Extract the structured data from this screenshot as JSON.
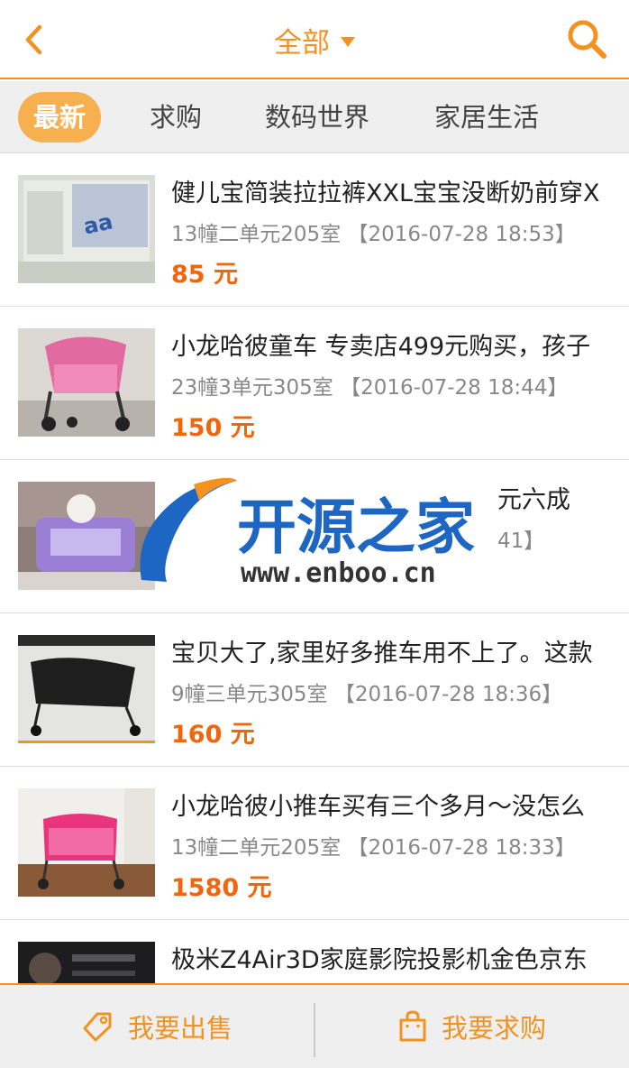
{
  "header": {
    "title": "全部",
    "accent_color": "#f39221",
    "back_icon": "chevron-left-icon",
    "search_icon": "search-icon"
  },
  "tabs": [
    {
      "label": "最新",
      "active": true
    },
    {
      "label": "求购",
      "active": false
    },
    {
      "label": "数码世界",
      "active": false
    },
    {
      "label": "家居生活",
      "active": false
    }
  ],
  "items": [
    {
      "title": "健儿宝简装拉拉裤XXL宝宝没断奶前穿X",
      "address": "13幢二单元205室",
      "time": "【2016-07-28 18:53】",
      "price": "85 元"
    },
    {
      "title": "小龙哈彼童车 专卖店499元购买，孩子",
      "address": "23幢3单元305室",
      "time": "【2016-07-28 18:44】",
      "price": "150 元"
    },
    {
      "title": "元六成",
      "address": "",
      "time": "41】",
      "price": ""
    },
    {
      "title": "宝贝大了,家里好多推车用不上了。这款",
      "address": "9幢三单元305室",
      "time": "【2016-07-28 18:36】",
      "price": "160 元"
    },
    {
      "title": "小龙哈彼小推车买有三个多月～没怎么",
      "address": "13幢二单元205室",
      "time": "【2016-07-28 18:33】",
      "price": "1580 元"
    },
    {
      "title": "极米Z4Air3D家庭影院投影机金色京东",
      "address": "",
      "time": "",
      "price": ""
    }
  ],
  "watermark": {
    "name": "开源之家",
    "url": "www.enboo.cn"
  },
  "bottom_bar": {
    "sell_label": "我要出售",
    "sell_icon": "price-tag-icon",
    "buy_label": "我要求购",
    "buy_icon": "shopping-bag-icon"
  }
}
